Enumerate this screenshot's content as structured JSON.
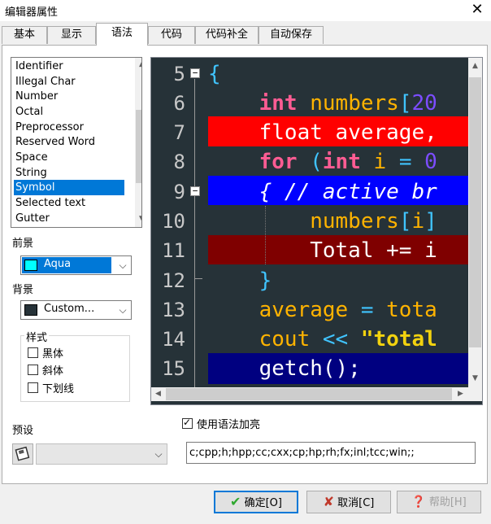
{
  "window": {
    "title": "编辑器属性",
    "close": "✕"
  },
  "tabs": [
    {
      "label": "基本"
    },
    {
      "label": "显示"
    },
    {
      "label": "语法"
    },
    {
      "label": "代码"
    },
    {
      "label": "代码补全"
    },
    {
      "label": "自动保存"
    }
  ],
  "element_list": {
    "items": [
      "Identifier",
      "Illegal Char",
      "Number",
      "Octal",
      "Preprocessor",
      "Reserved Word",
      "Space",
      "String",
      "Symbol",
      "Selected text",
      "Gutter"
    ],
    "selected": "Symbol"
  },
  "foreground": {
    "label": "前景",
    "value": "Aqua",
    "color": "#00ffff"
  },
  "background": {
    "label": "背景",
    "value": "Custom...",
    "color": "#263238"
  },
  "style_group": {
    "legend": "样式",
    "bold": {
      "label": "黑体",
      "checked": false
    },
    "italic": {
      "label": "斜体",
      "checked": false
    },
    "underline": {
      "label": "下划线",
      "checked": false
    }
  },
  "preview": {
    "line_numbers": [
      "5",
      "6",
      "7",
      "8",
      "9",
      "10",
      "11",
      "12",
      "13",
      "14",
      "15"
    ],
    "fold_markers": [
      "−",
      "−"
    ],
    "lines": [
      [
        {
          "t": "{",
          "c": "sym"
        }
      ],
      [
        {
          "t": "    ",
          "c": "white"
        },
        {
          "t": "int",
          "c": "kw"
        },
        {
          "t": " numbers",
          "c": "id"
        },
        {
          "t": "[",
          "c": "sym"
        },
        {
          "t": "20",
          "c": "num"
        }
      ],
      [
        {
          "t": "    float",
          "c": "white"
        },
        {
          "t": " average,",
          "c": "white"
        }
      ],
      [
        {
          "t": "    ",
          "c": "white"
        },
        {
          "t": "for",
          "c": "kw"
        },
        {
          "t": " (",
          "c": "sym"
        },
        {
          "t": "int",
          "c": "kw"
        },
        {
          "t": " i ",
          "c": "id"
        },
        {
          "t": "=",
          "c": "sym"
        },
        {
          "t": " 0",
          "c": "num"
        }
      ],
      [
        {
          "t": "    { // active br",
          "c": "cmt"
        }
      ],
      [
        {
          "t": "        numbers",
          "c": "id"
        },
        {
          "t": "[",
          "c": "sym"
        },
        {
          "t": "i",
          "c": "id"
        },
        {
          "t": "]",
          "c": "sym"
        }
      ],
      [
        {
          "t": "        Total += i",
          "c": "white"
        }
      ],
      [
        {
          "t": "    }",
          "c": "sym"
        }
      ],
      [
        {
          "t": "    average ",
          "c": "id"
        },
        {
          "t": "=",
          "c": "sym"
        },
        {
          "t": " tota",
          "c": "id"
        }
      ],
      [
        {
          "t": "    cout ",
          "c": "id"
        },
        {
          "t": "<<",
          "c": "sym"
        },
        {
          "t": " \"total",
          "c": "str"
        }
      ],
      [
        {
          "t": "    getch();",
          "c": "white"
        }
      ]
    ],
    "line_backgrounds": [
      "",
      "",
      "#ff0000",
      "",
      "#0000ff",
      "",
      "#7f0000",
      "",
      "",
      "",
      "#000080"
    ]
  },
  "presets": {
    "label": "预设",
    "value": ""
  },
  "syntax_highlight": {
    "label": "使用语法加亮",
    "checked": true
  },
  "extensions": {
    "value": "c;cpp;h;hpp;cc;cxx;cp;hp;rh;fx;inl;tcc;win;;"
  },
  "buttons": {
    "ok": "确定[O]",
    "cancel": "取消[C]",
    "help": "帮助[H]"
  },
  "icons": {
    "ok": "check-icon",
    "cancel": "x-icon",
    "help": "question-icon"
  },
  "colors": {
    "accent": "#0078d7",
    "ok_icon": "#2fa82f",
    "cancel_icon": "#c0392b"
  }
}
